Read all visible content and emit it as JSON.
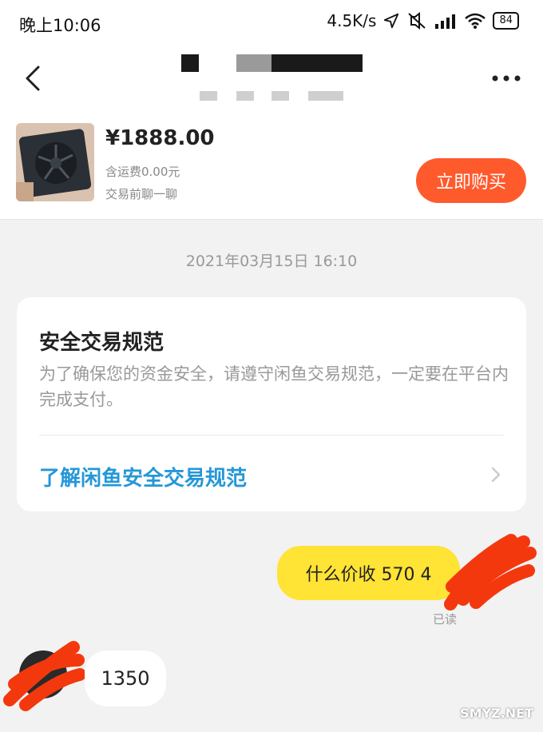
{
  "status_bar": {
    "time": "晚上10:06",
    "network_speed": "4.5K/s",
    "battery": "84",
    "icons": [
      "location-icon",
      "mute-icon",
      "signal-icon",
      "wifi-icon",
      "battery-icon"
    ]
  },
  "nav": {
    "back_icon": "chevron-left-icon",
    "more_icon": "more-icon"
  },
  "product": {
    "price": "¥1888.00",
    "shipping": "含运费0.00元",
    "chat_hint": "交易前聊一聊",
    "buy_label": "立即购买"
  },
  "conversation": {
    "timestamp": "2021年03月15日 16:10",
    "safety_card": {
      "title": "安全交易规范",
      "body": "为了确保您的资金安全，请遵守闲鱼交易规范，一定要在平台内完成支付。",
      "link": "了解闲鱼安全交易规范"
    },
    "messages": [
      {
        "direction": "out",
        "text": "什么价收 570 4",
        "status": "已读"
      },
      {
        "direction": "in",
        "text": "1350"
      }
    ]
  },
  "watermark": "SMYZ.NET",
  "colors": {
    "buy_button": "#ff5a2c",
    "outgoing_bubble": "#ffe335",
    "link": "#2597d8",
    "redaction_scribble": "#f4380e"
  }
}
